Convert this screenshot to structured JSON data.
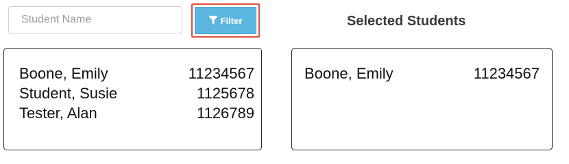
{
  "search": {
    "placeholder": "Student Name",
    "value": ""
  },
  "filter_button": {
    "label": "Filter",
    "icon": "funnel-icon",
    "color": "#5bb6e0",
    "highlight_color": "#e0503a"
  },
  "selected_section": {
    "title": "Selected Students"
  },
  "available_students": [
    {
      "name": "Boone, Emily",
      "id": "11234567"
    },
    {
      "name": "Student, Susie",
      "id": "1125678"
    },
    {
      "name": "Tester, Alan",
      "id": "1126789"
    }
  ],
  "selected_students": [
    {
      "name": "Boone, Emily",
      "id": "11234567"
    }
  ]
}
